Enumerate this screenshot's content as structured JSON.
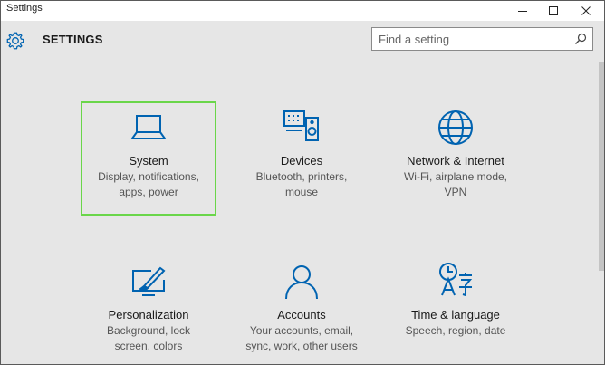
{
  "window": {
    "title": "Settings"
  },
  "header": {
    "heading": "SETTINGS"
  },
  "search": {
    "placeholder": "Find a setting"
  },
  "accent_color": "#0063b1",
  "selection_color": "#6ad64a",
  "tiles": [
    {
      "name": "System",
      "desc1": "Display, notifications,",
      "desc2": "apps, power",
      "icon": "laptop-icon"
    },
    {
      "name": "Devices",
      "desc1": "Bluetooth, printers,",
      "desc2": "mouse",
      "icon": "devices-icon"
    },
    {
      "name": "Network & Internet",
      "desc1": "Wi-Fi, airplane mode,",
      "desc2": "VPN",
      "icon": "globe-icon"
    },
    {
      "name": "Personalization",
      "desc1": "Background, lock",
      "desc2": "screen, colors",
      "icon": "paint-icon"
    },
    {
      "name": "Accounts",
      "desc1": "Your accounts, email,",
      "desc2": "sync, work, other users",
      "icon": "person-icon"
    },
    {
      "name": "Time & language",
      "desc1": "Speech, region, date",
      "desc2": "",
      "icon": "language-icon"
    }
  ]
}
